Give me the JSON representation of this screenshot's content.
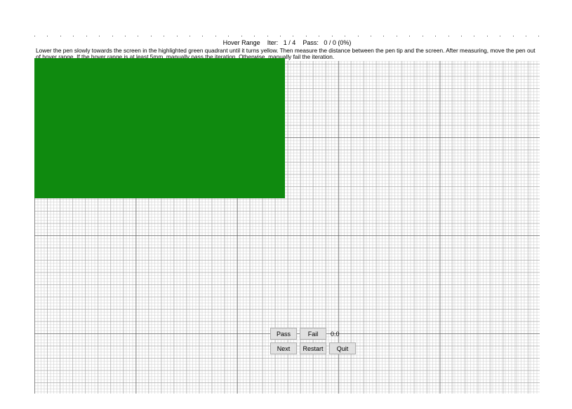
{
  "header": {
    "title_prefix": "Hover Range",
    "iter_label": "Iter:",
    "iter_value": "1 / 4",
    "pass_label": "Pass:",
    "pass_value": "0 / 0 (0%)"
  },
  "instructions": "Lower the pen slowly towards the screen in the highlighted green quadrant until it turns yellow. Then measure the distance between the pen tip and the screen. After measuring, move the pen out of hover range. If the hover range is at least 5mm, manually pass the iteration. Otherwise, manually fail the iteration.",
  "quadrant": {
    "color": "#0f8a0f",
    "state": "green"
  },
  "controls": {
    "pass_label": "Pass",
    "fail_label": "Fail",
    "next_label": "Next",
    "restart_label": "Restart",
    "quit_label": "Quit",
    "readout_value": "0.0"
  }
}
